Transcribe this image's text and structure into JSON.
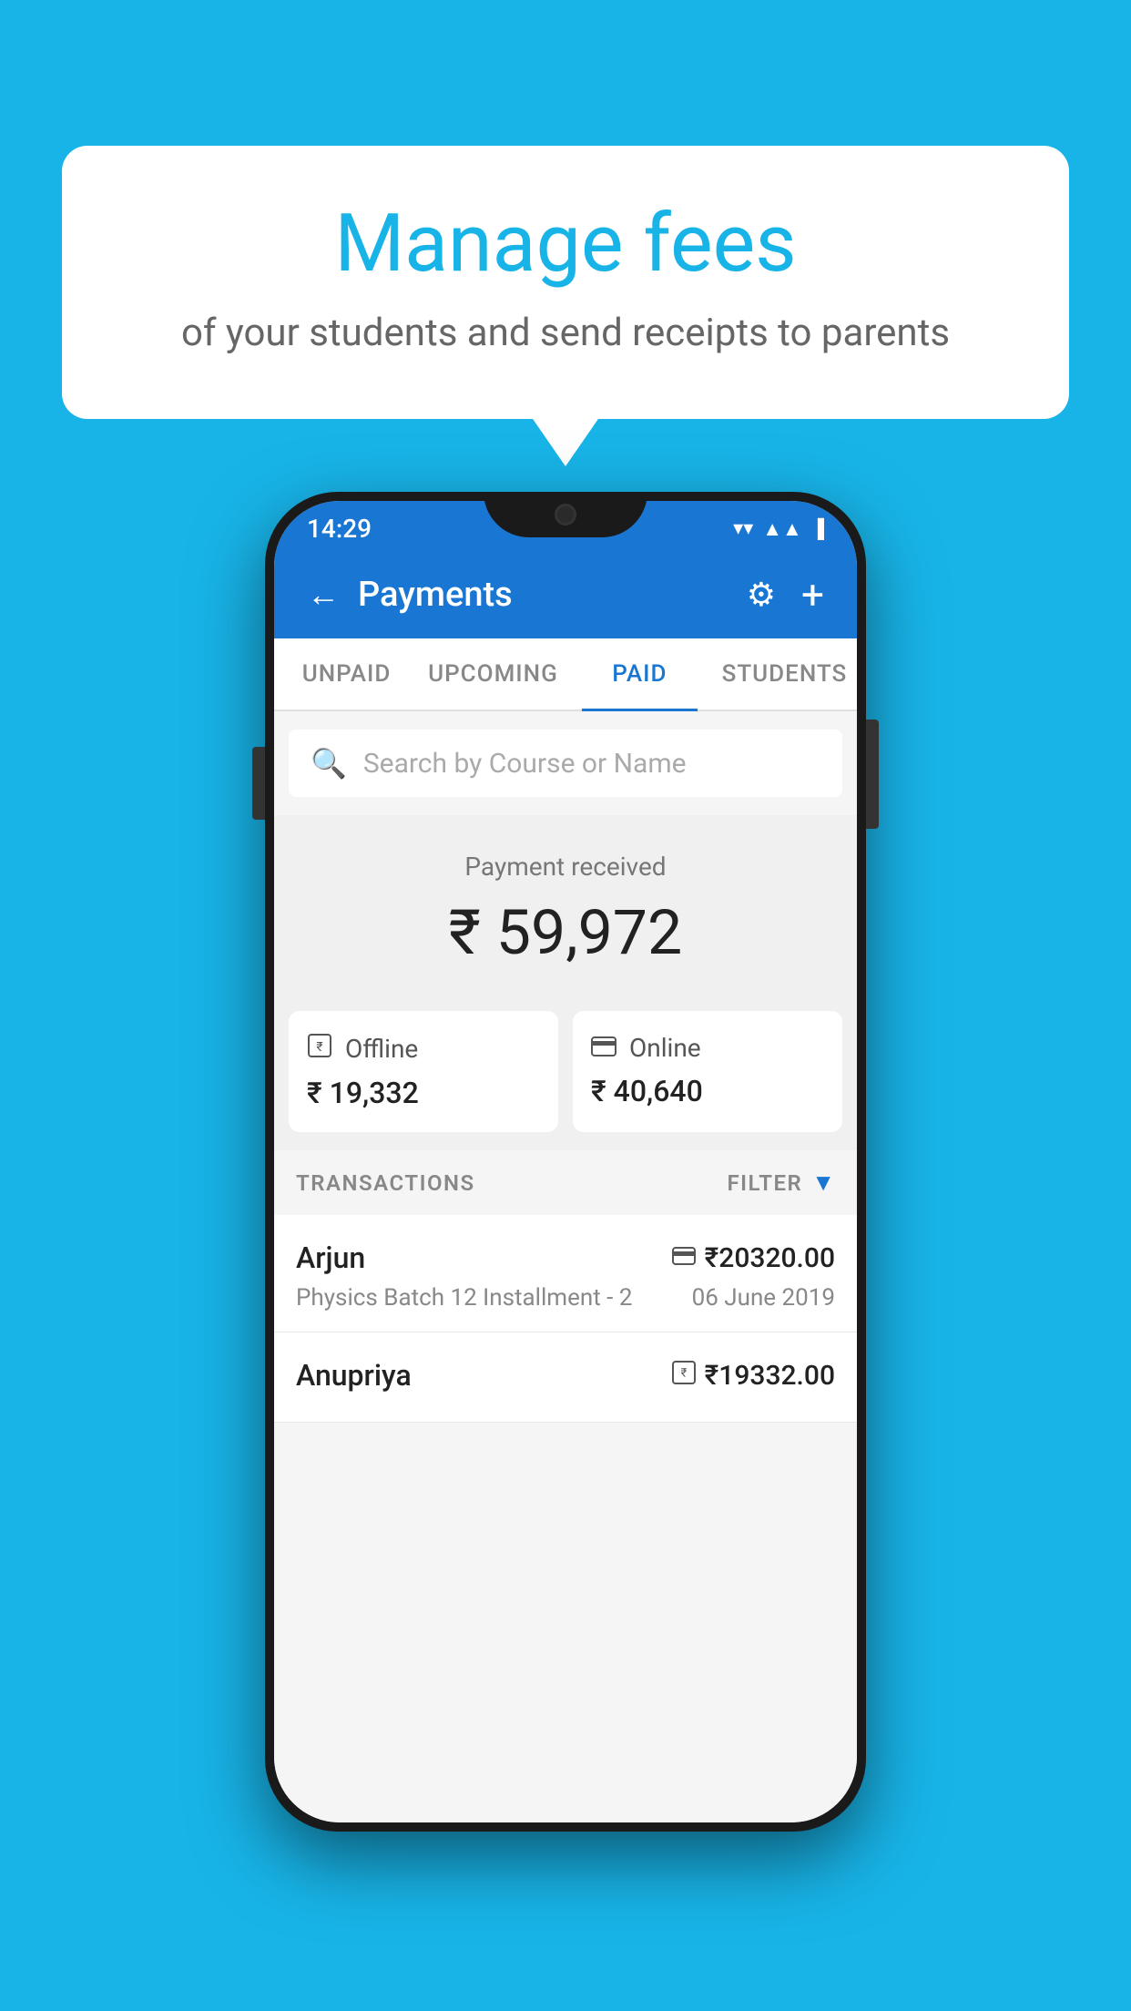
{
  "background_color": "#18b4e8",
  "speech_bubble": {
    "title": "Manage fees",
    "subtitle": "of your students and send receipts to parents"
  },
  "phone": {
    "status_bar": {
      "time": "14:29"
    },
    "app_bar": {
      "title": "Payments",
      "back_label": "←",
      "settings_label": "⚙",
      "add_label": "+"
    },
    "tabs": [
      {
        "label": "UNPAID",
        "active": false
      },
      {
        "label": "UPCOMING",
        "active": false
      },
      {
        "label": "PAID",
        "active": true
      },
      {
        "label": "STUDENTS",
        "active": false
      }
    ],
    "search": {
      "placeholder": "Search by Course or Name"
    },
    "payment_summary": {
      "label": "Payment received",
      "amount": "₹ 59,972",
      "offline": {
        "icon": "💳",
        "label": "Offline",
        "amount": "₹ 19,332"
      },
      "online": {
        "icon": "💳",
        "label": "Online",
        "amount": "₹ 40,640"
      }
    },
    "transactions_header": {
      "label": "TRANSACTIONS",
      "filter_label": "FILTER"
    },
    "transactions": [
      {
        "name": "Arjun",
        "course": "Physics Batch 12 Installment - 2",
        "amount": "₹20320.00",
        "date": "06 June 2019",
        "type": "online"
      },
      {
        "name": "Anupriya",
        "course": "",
        "amount": "₹19332.00",
        "date": "",
        "type": "offline"
      }
    ]
  }
}
